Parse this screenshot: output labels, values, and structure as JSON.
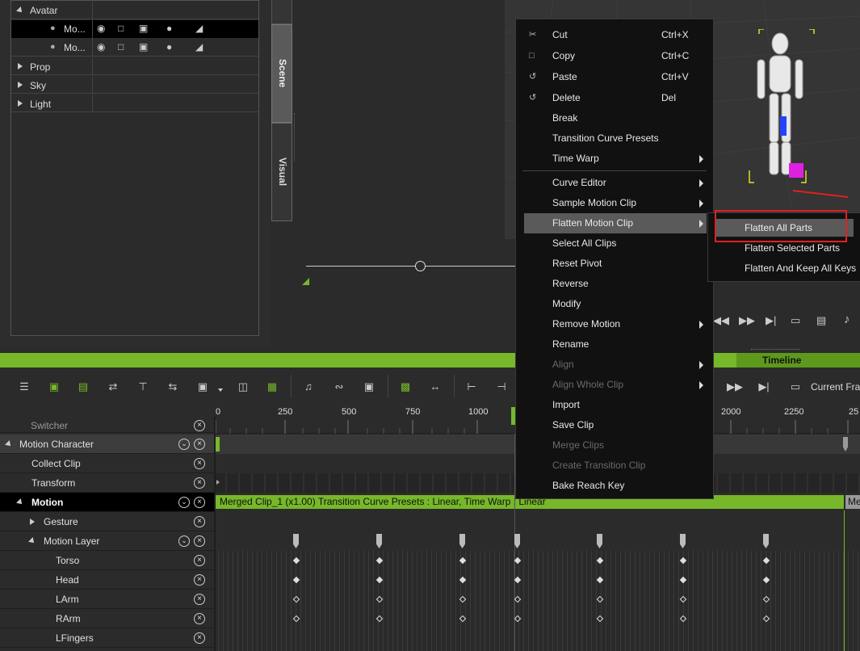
{
  "scene_tree": {
    "avatar_label": "Avatar",
    "avatar_rows": [
      {
        "name": "Mo..."
      },
      {
        "name": "Mo..."
      }
    ],
    "categories": [
      {
        "label": "Prop"
      },
      {
        "label": "Sky"
      },
      {
        "label": "Light"
      }
    ]
  },
  "side_tabs": {
    "scene": "Scene",
    "visual": "Visual"
  },
  "context_menu": {
    "items": [
      {
        "label": "Cut",
        "shortcut": "Ctrl+X",
        "icon": "cut-icon"
      },
      {
        "label": "Copy",
        "shortcut": "Ctrl+C",
        "icon": "copy-icon"
      },
      {
        "label": "Paste",
        "shortcut": "Ctrl+V",
        "icon": "paste-icon"
      },
      {
        "label": "Delete",
        "shortcut": "Del",
        "icon": "delete-icon"
      },
      {
        "label": "Break"
      },
      {
        "label": "Transition Curve Presets"
      },
      {
        "label": "Time Warp",
        "submenu": true
      },
      {
        "label": "Curve Editor",
        "submenu": true
      },
      {
        "label": "Sample Motion Clip",
        "submenu": true
      },
      {
        "label": "Flatten Motion Clip",
        "submenu": true,
        "highlighted": true
      },
      {
        "label": "Select All Clips"
      },
      {
        "label": "Reset Pivot"
      },
      {
        "label": "Reverse"
      },
      {
        "label": "Modify"
      },
      {
        "label": "Remove Motion",
        "submenu": true
      },
      {
        "label": "Rename"
      },
      {
        "label": "Align",
        "submenu": true,
        "disabled": true
      },
      {
        "label": "Align Whole Clip",
        "submenu": true,
        "disabled": true
      },
      {
        "label": "Import"
      },
      {
        "label": "Save Clip"
      },
      {
        "label": "Merge Clips",
        "disabled": true
      },
      {
        "label": "Create Transition Clip",
        "disabled": true
      },
      {
        "label": "Bake Reach Key"
      }
    ]
  },
  "submenu": {
    "items": [
      {
        "label": "Flatten All Parts",
        "highlighted": true
      },
      {
        "label": "Flatten Selected Parts"
      },
      {
        "label": "Flatten And Keep All Keys"
      }
    ]
  },
  "timeline": {
    "title": "Timeline",
    "current_frame_label": "Current Fra",
    "ruler_ticks": [
      "0",
      "250",
      "500",
      "750",
      "1000",
      "2000",
      "2250",
      "25"
    ],
    "tracks": [
      {
        "label": "Switcher"
      },
      {
        "label": "Motion Character"
      },
      {
        "label": "Collect Clip"
      },
      {
        "label": "Transform"
      },
      {
        "label": "Motion"
      },
      {
        "label": "Gesture"
      },
      {
        "label": "Motion Layer"
      },
      {
        "label": "Torso"
      },
      {
        "label": "Head"
      },
      {
        "label": "LArm"
      },
      {
        "label": "RArm"
      },
      {
        "label": "LFingers"
      }
    ],
    "clip_label": "Merged Clip_1 (x1.00) Transition Curve Presets : Linear, Time Warp : Linear",
    "clip2_label": "Me"
  },
  "colors": {
    "accent": "#76b82a",
    "highlight": "#5a5a5a",
    "menu_bg": "#111111",
    "red_box": "#e02020"
  }
}
